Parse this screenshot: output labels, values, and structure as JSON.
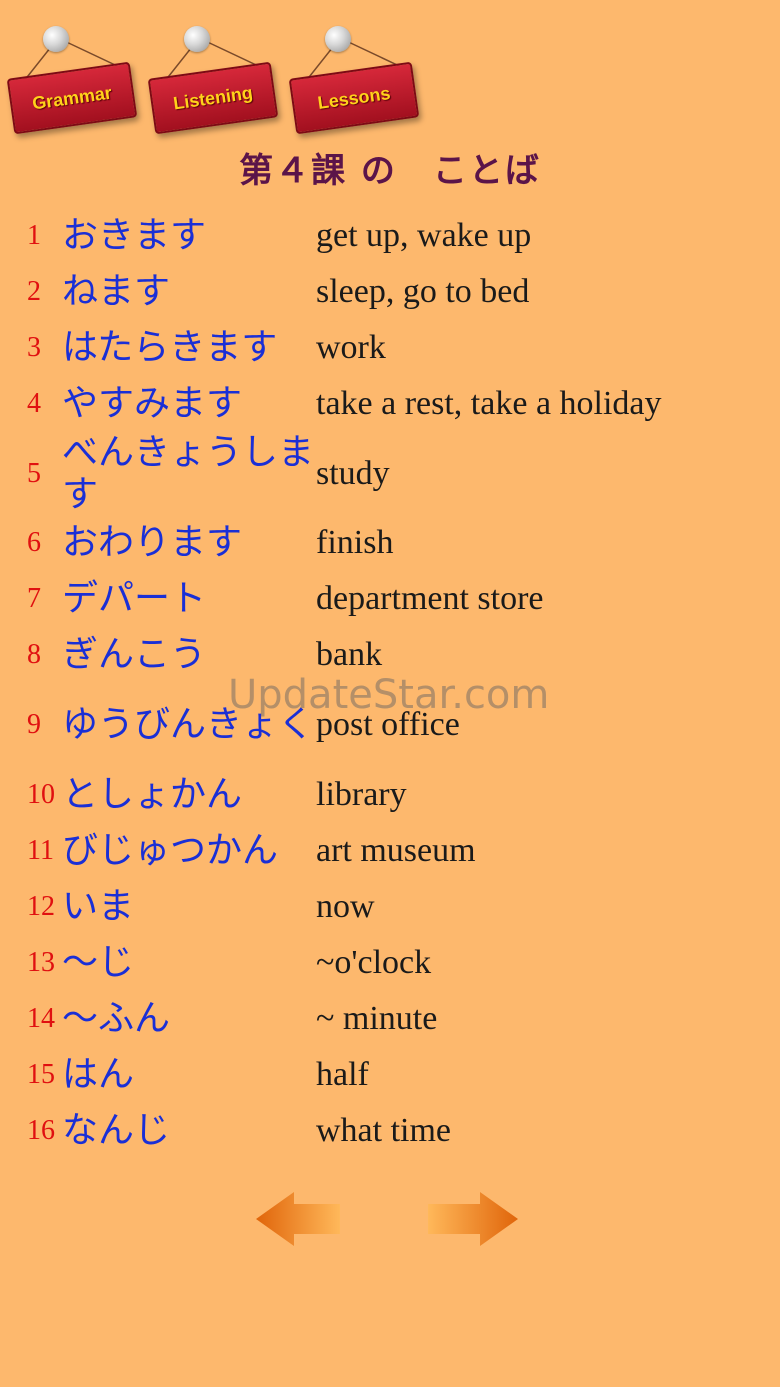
{
  "nav": {
    "grammar": "Grammar",
    "listening": "Listening",
    "lessons": "Lessons"
  },
  "title": "第４課 の　ことば",
  "vocab": [
    {
      "n": "1",
      "jp": "おきます",
      "en": "get up, wake up"
    },
    {
      "n": "2",
      "jp": "ねます",
      "en": "sleep, go to bed"
    },
    {
      "n": "3",
      "jp": "はたらきます",
      "en": "work"
    },
    {
      "n": "4",
      "jp": "やすみます",
      "en": "take a rest, take a holiday"
    },
    {
      "n": "5",
      "jp": "べんきょうします",
      "en": "study"
    },
    {
      "n": "6",
      "jp": "おわります",
      "en": "finish"
    },
    {
      "n": "7",
      "jp": "デパート",
      "en": "department store"
    },
    {
      "n": "8",
      "jp": "ぎんこう",
      "en": "bank"
    },
    {
      "n": "9",
      "jp": "ゆうびんきょく",
      "en": "post office"
    },
    {
      "n": "10",
      "jp": "としょかん",
      "en": "library"
    },
    {
      "n": "11",
      "jp": "びじゅつかん",
      "en": "art museum"
    },
    {
      "n": "12",
      "jp": "いま",
      "en": "now"
    },
    {
      "n": "13",
      "jp": "～じ",
      "en": "~o'clock"
    },
    {
      "n": "14",
      "jp": "～ふん",
      "en": "~ minute"
    },
    {
      "n": "15",
      "jp": "はん",
      "en": "half"
    },
    {
      "n": "16",
      "jp": "なんじ",
      "en": "what time"
    }
  ],
  "watermark": "UpdateStar.com",
  "icons": {
    "prev": "arrow-left-icon",
    "next": "arrow-right-icon"
  },
  "colors": {
    "background": "#fdb86d",
    "number": "#e01010",
    "japanese": "#1a2fd6",
    "title": "#5b1449",
    "sign": "#c41e2e",
    "sign_text": "#ffd21a",
    "arrow": "#f0801e"
  }
}
